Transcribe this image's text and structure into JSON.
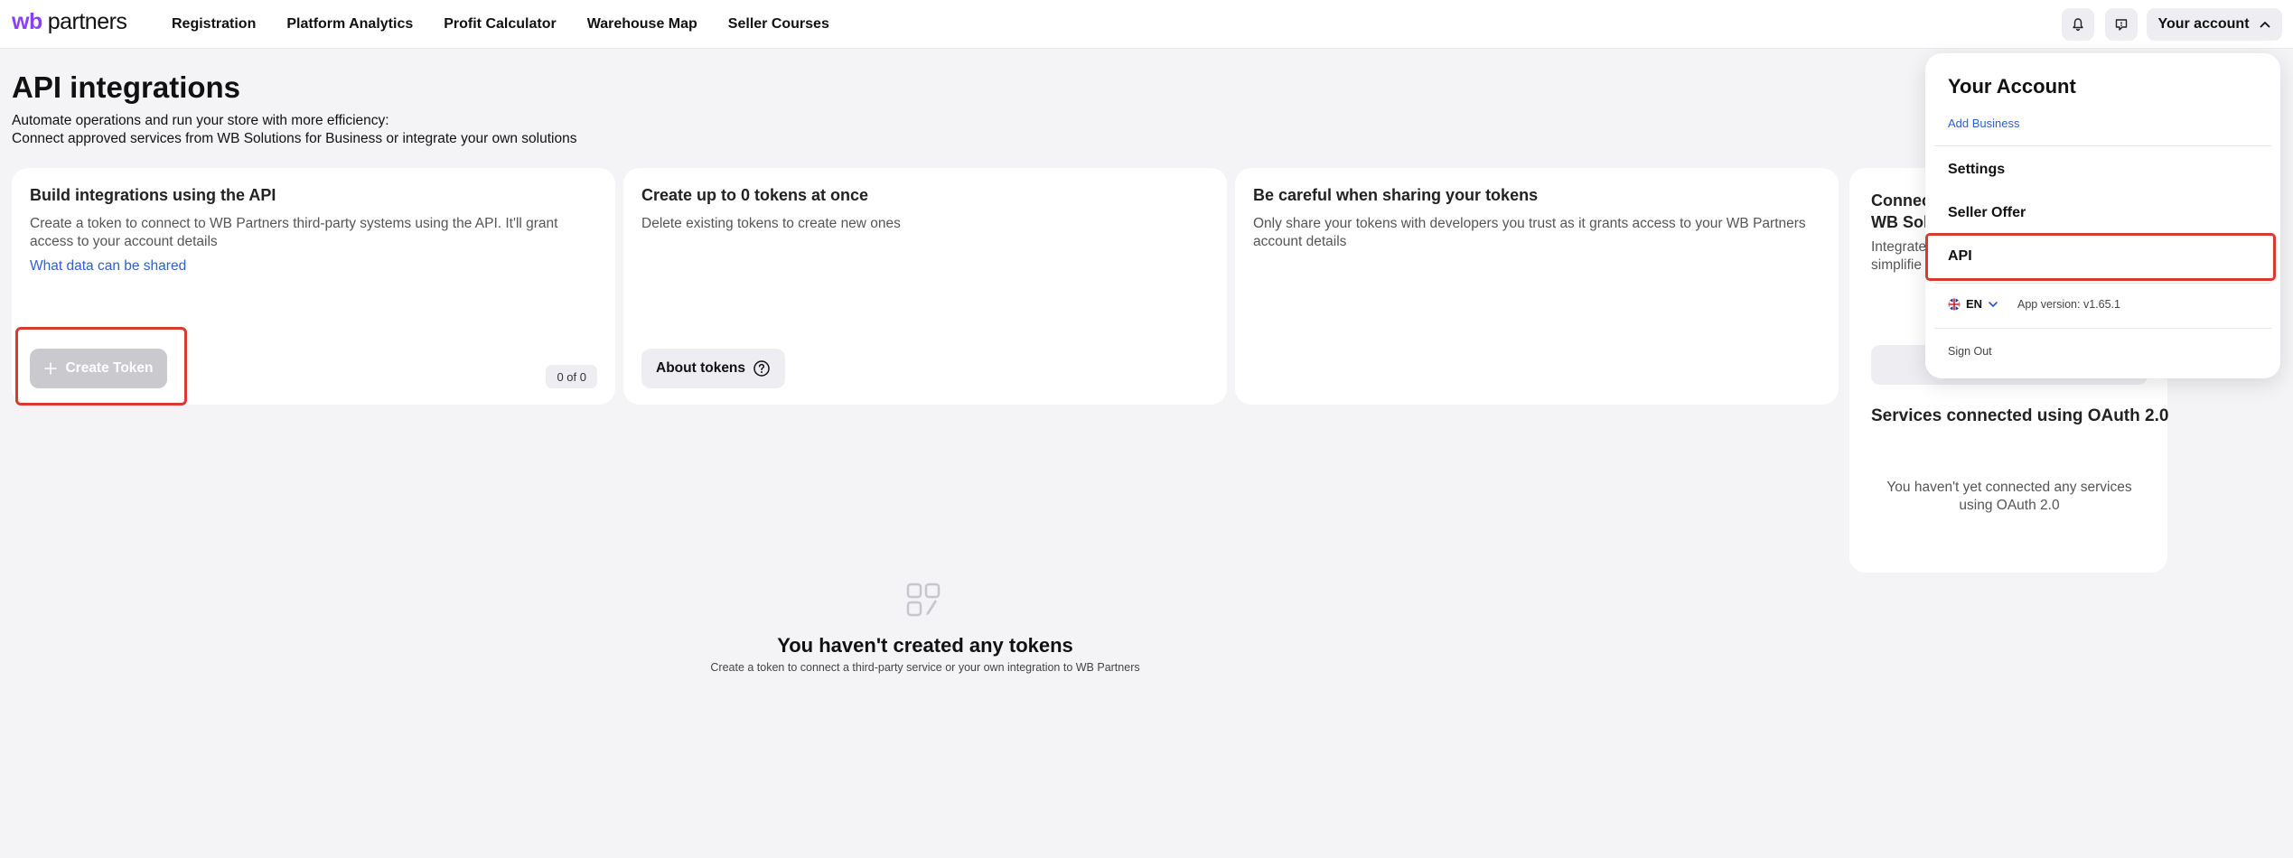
{
  "header": {
    "logo_wb": "wb",
    "logo_partners": "partners",
    "nav": [
      "Registration",
      "Platform Analytics",
      "Profit Calculator",
      "Warehouse Map",
      "Seller Courses"
    ],
    "icons": [
      "bell-icon",
      "chat-icon"
    ],
    "account_label": "Your account"
  },
  "page": {
    "title": "API integrations",
    "subtitle_line1": "Automate operations and run your store with more efficiency:",
    "subtitle_line2": "Connect approved services from WB Solutions for Business or integrate your own solutions"
  },
  "cards": {
    "build": {
      "title": "Build integrations using the API",
      "text": "Create a token to connect to WB Partners third-party systems using the API. It'll grant access to your account details",
      "link": "What data can be shared",
      "button": "Create Token",
      "count": "0 of 0"
    },
    "create_up_to": {
      "title": "Create up to 0 tokens at once",
      "text": "Delete existing tokens to create new ones",
      "button": "About tokens"
    },
    "careful": {
      "title": "Be careful when sharing your tokens",
      "text": "Only share your tokens with developers you trust as it grants access to your WB Partners account details"
    },
    "connect": {
      "title_line1": "Connec",
      "title_line2": "WB Solu",
      "desc_line1": "Integrate",
      "desc_line2": "simplifie",
      "oauth_title": "Services connected using OAuth 2.0",
      "oauth_empty": "You haven't yet connected any services using OAuth 2.0"
    }
  },
  "empty_state": {
    "title": "You haven't created any tokens",
    "desc": "Create a token to connect a third-party service or your own integration to WB Partners"
  },
  "dropdown": {
    "title": "Your Account",
    "add_business": "Add Business",
    "items": [
      "Settings",
      "Seller Offer",
      "API"
    ],
    "lang": "EN",
    "app_version": "App version: v1.65.1",
    "sign_out": "Sign Out"
  },
  "colors": {
    "brand": "#8a3ffc",
    "link": "#3060c8",
    "highlight": "#d83a2f",
    "disabled_button": "#c9c9ce"
  }
}
